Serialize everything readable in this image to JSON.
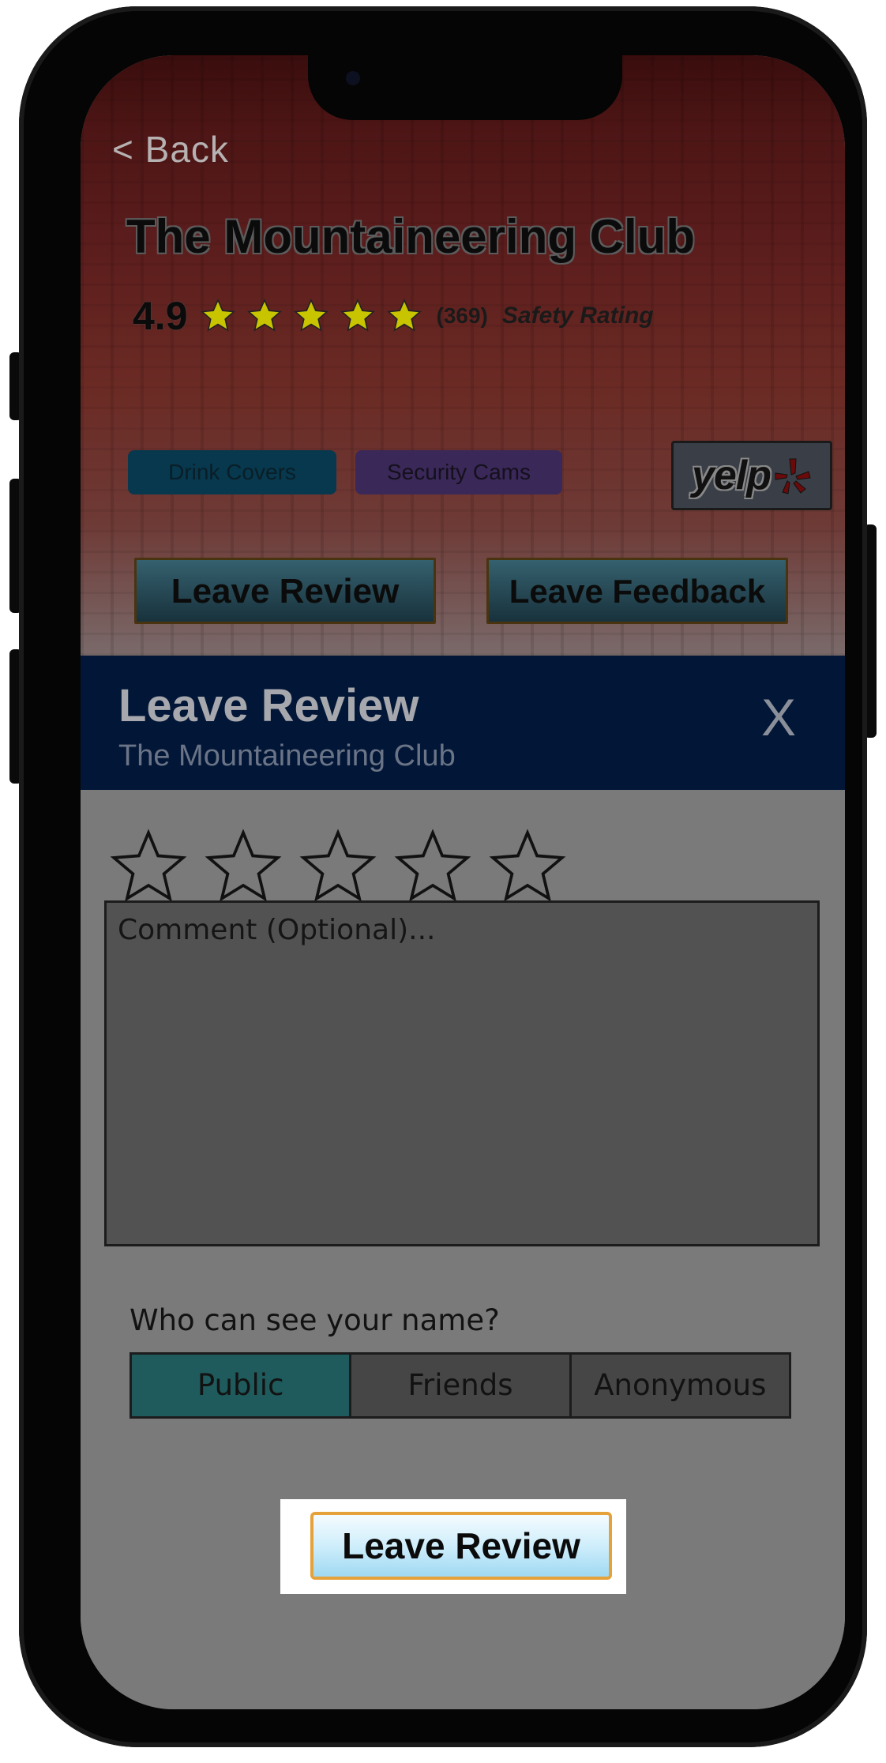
{
  "header": {
    "back_label": "< Back",
    "venue_name": "The Mountaineering Club",
    "rating_value": "4.9",
    "rating_stars": 5,
    "rating_count": "(369)",
    "rating_label": "Safety Rating",
    "tags": [
      "Drink Covers",
      "Security Cams"
    ],
    "yelp_logo": "yelp",
    "leave_review_label": "Leave Review",
    "leave_feedback_label": "Leave Feedback"
  },
  "modal": {
    "title": "Leave Review",
    "subtitle": "The Mountaineering Club",
    "close_label": "X",
    "star_input_count": 5,
    "selected_stars": 0,
    "comment_placeholder": "Comment (Optional)...",
    "comment_value": "",
    "visibility_question": "Who can see your name?",
    "visibility_options": [
      "Public",
      "Friends",
      "Anonymous"
    ],
    "visibility_selected": "Public",
    "submit_label": "Leave Review"
  },
  "colors": {
    "modal_header_bg": "#021637",
    "rating_star": "#c9c400",
    "selected_segment": "#1f5a5c",
    "submit_border": "#e6a23a"
  }
}
